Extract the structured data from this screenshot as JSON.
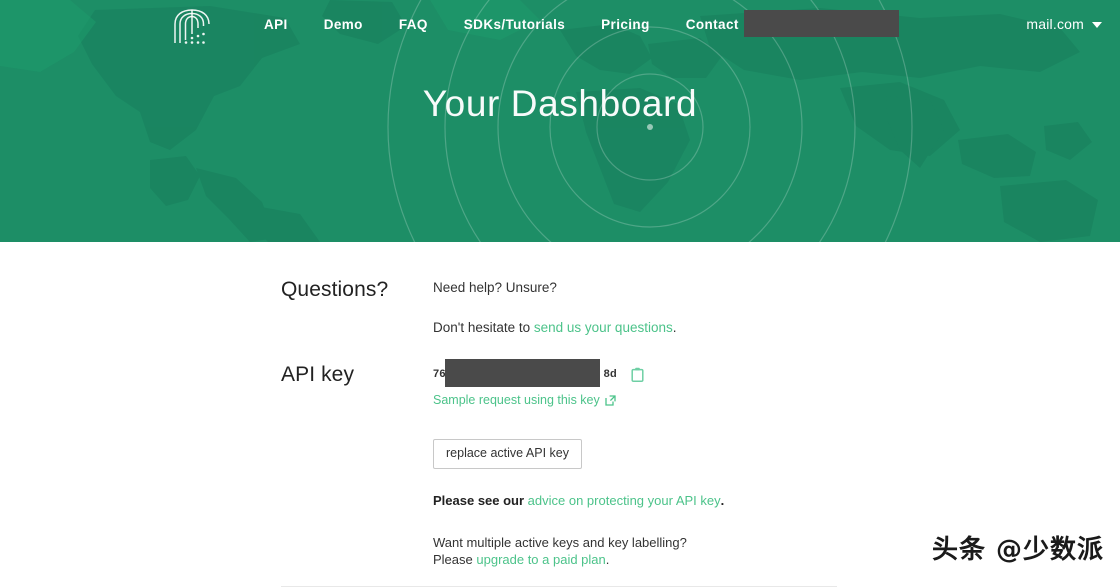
{
  "brand": {
    "logo_icon": "fountain-dome-logo",
    "hero_title": "Your Dashboard"
  },
  "nav": {
    "items": [
      {
        "label": "API"
      },
      {
        "label": "Demo"
      },
      {
        "label": "FAQ"
      },
      {
        "label": "SDKs/Tutorials"
      },
      {
        "label": "Pricing"
      },
      {
        "label": "Contact"
      }
    ]
  },
  "account": {
    "email_visible": "mail.com",
    "redacted": true,
    "caret_icon": "chevron-down-icon"
  },
  "sections": {
    "questions": {
      "title": "Questions?",
      "line1": "Need help? Unsure?",
      "line2_prefix": "Don't hesitate to ",
      "line2_link": "send us your questions",
      "line2_suffix": "."
    },
    "api_key": {
      "title": "API key",
      "key_prefix": "76",
      "key_suffix": "8d",
      "copy_icon": "clipboard-copy-icon",
      "sample_link": "Sample request using this key",
      "external_icon": "external-link-icon",
      "replace_button": "replace active API key",
      "advice_prefix": "Please see our ",
      "advice_link": "advice on protecting your API key",
      "advice_suffix": ".",
      "upgrade_line1": "Want multiple active keys and key labelling?",
      "upgrade_prefix": "Please ",
      "upgrade_link": "upgrade to a paid plan",
      "upgrade_suffix": "."
    }
  },
  "watermark": {
    "text": "头条 @少数派"
  },
  "colors": {
    "hero_green": "#1d8e66",
    "link_green": "#4cc38a",
    "redaction": "#4a4a4a",
    "divider": "#e8e8e8"
  }
}
